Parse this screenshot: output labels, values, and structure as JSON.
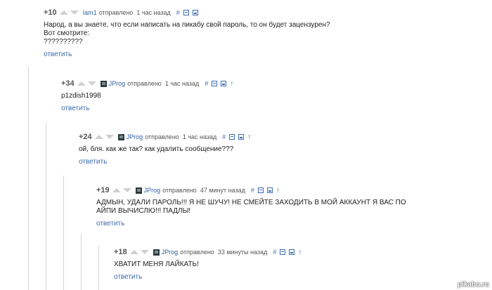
{
  "comments": [
    {
      "rating": "+10",
      "user": "Iam1",
      "sent": "отправлено",
      "time": "1 час назад",
      "tools": {
        "link": "#"
      },
      "lines": [
        "Народ, а вы знаете, что если написать на пикабу свой пароль, то он будет зацензурен?",
        "Вот смотрите:",
        "??????????"
      ],
      "reply": "ответить"
    },
    {
      "rating": "+34",
      "user": "JProg",
      "sent": "отправлено",
      "time": "1 час назад",
      "tools": {
        "link": "#",
        "parent": "↑"
      },
      "lines": [
        "p1zdish1998"
      ],
      "reply": "ответить"
    },
    {
      "rating": "+24",
      "user": "JProg",
      "sent": "отправлено",
      "time": "1 час назад",
      "tools": {
        "link": "#",
        "parent": "↑"
      },
      "lines": [
        "ой, бля. как же так? как удалить сообщение???"
      ],
      "reply": "ответить"
    },
    {
      "rating": "+19",
      "user": "JProg",
      "sent": "отправлено",
      "time": "47 минут назад",
      "tools": {
        "link": "#",
        "parent": "↑"
      },
      "lines": [
        "АДМЫН, УДАЛИ ПАРОЛЬ!!! Я НЕ ШУЧУ! НЕ СМЕЙТЕ ЗАХОДИТЬ В МОЙ АККАУНТ Я ВАС ПО",
        "АЙПИ ВЫЧИСЛЮ!!! ПАДЛЫ!"
      ],
      "reply": "ответить"
    },
    {
      "rating": "+18",
      "user": "JProg",
      "sent": "отправлено",
      "time": "33 минуты назад",
      "tools": {
        "link": "#",
        "parent": "↑"
      },
      "lines": [
        "ХВАТИТ МЕНЯ ЛАЙКАТЬ!"
      ],
      "reply": "ответить"
    }
  ],
  "watermark": "pikabu.ru"
}
